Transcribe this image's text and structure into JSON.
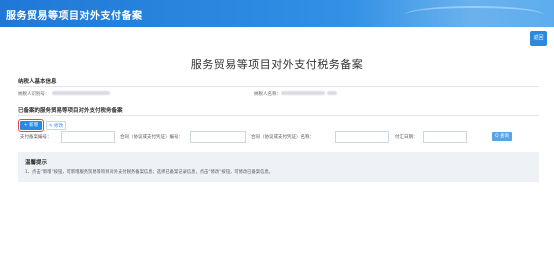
{
  "header": {
    "title": "服务贸易等项目对外支付备案"
  },
  "toolbar": {
    "return_label": "返回"
  },
  "page": {
    "title": "服务贸易等项目对外支付税务备案"
  },
  "taxpayer": {
    "section_title": "纳税人基本信息",
    "id_label": "纳税人识别号：",
    "name_label": "纳税人名称："
  },
  "records": {
    "section_title": "已备案的服务贸易等项目对外支付税务备案",
    "add_label": "+ 新增",
    "edit_label": "✎ 修改"
  },
  "filters": {
    "record_no_label": "支付备案编号：",
    "contract_no_label": "合同（协议或支付凭证）编号：",
    "contract_name_label": "合同（协议或支付凭证）名称：",
    "pay_date_label": "付汇日期：",
    "search_label": "Q 查询"
  },
  "notice": {
    "title": "温馨提示",
    "text": "1、点击“新增”按钮，可新增服务贸易等项目对外支付税务备案信息；选择已备案记录信息，点击“修改”按钮，可修改已备案信息。"
  },
  "colors": {
    "header": "#1f78d6",
    "accent": "#2b8ae0",
    "notice_bg": "#eef2f6"
  }
}
